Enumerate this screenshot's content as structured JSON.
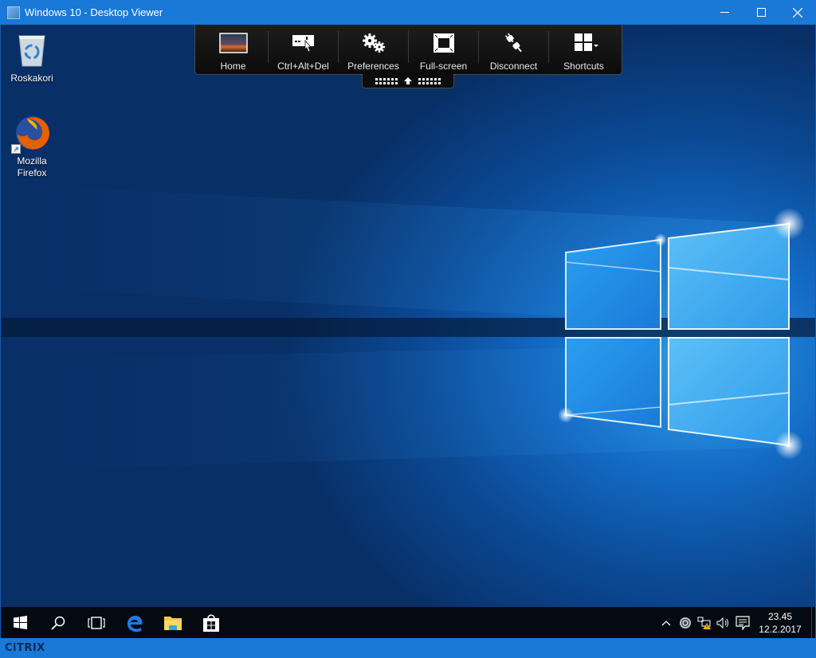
{
  "window": {
    "title": "Windows 10 - Desktop Viewer",
    "controls": {
      "minimize_icon": "minimize-icon",
      "maximize_icon": "maximize-icon",
      "close_icon": "close-icon"
    }
  },
  "toolbar": {
    "items": [
      {
        "label": "Home",
        "icon": "home-thumbnail-icon"
      },
      {
        "label": "Ctrl+Alt+Del",
        "icon": "ctrl-alt-del-icon"
      },
      {
        "label": "Preferences",
        "icon": "gears-icon"
      },
      {
        "label": "Full-screen",
        "icon": "fullscreen-icon"
      },
      {
        "label": "Disconnect",
        "icon": "plug-icon"
      },
      {
        "label": "Shortcuts",
        "icon": "grid-dropdown-icon"
      }
    ],
    "handle_icon": "arrow-up-icon"
  },
  "desktop": {
    "icons": [
      {
        "label": "Roskakori",
        "icon": "recycle-bin-icon"
      },
      {
        "label_line1": "Mozilla",
        "label_line2": "Firefox",
        "icon": "firefox-icon"
      }
    ],
    "wallpaper": "windows-10-hero"
  },
  "taskbar": {
    "buttons": [
      {
        "name": "start",
        "icon": "windows-logo-icon"
      },
      {
        "name": "search",
        "icon": "search-icon"
      },
      {
        "name": "task-view",
        "icon": "task-view-icon"
      },
      {
        "name": "edge",
        "icon": "edge-icon"
      },
      {
        "name": "file-explorer",
        "icon": "folder-icon"
      },
      {
        "name": "store",
        "icon": "store-icon"
      }
    ],
    "tray": {
      "icons": [
        "chevron-up-icon",
        "citrix-receiver-icon",
        "network-warning-icon",
        "volume-icon",
        "action-center-icon"
      ],
      "time": "23.45",
      "date": "12.2.2017"
    }
  },
  "status_bar": {
    "brand": "CiTRIX"
  },
  "colors": {
    "titlebar": "#1a78d6",
    "taskbar": "#050a12",
    "toolbar": "#111111",
    "accent_edge": "#1e7ce0"
  }
}
